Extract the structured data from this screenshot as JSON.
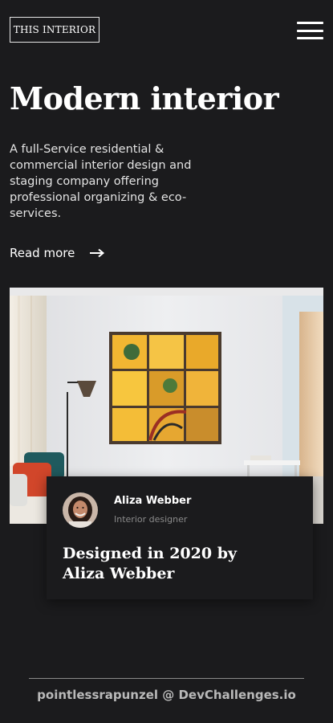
{
  "header": {
    "logo_text": "THIS INTERIOR",
    "menu_icon": "hamburger-menu-icon"
  },
  "hero": {
    "title": "Modern interior",
    "description": "A full-Service residential & commercial interior design and staging company offering professional organizing & eco-services.",
    "read_more_label": "Read more",
    "read_more_icon": "arrow-right-icon",
    "image": "living-room-interior-photo"
  },
  "card": {
    "author_name": "Aliza Webber",
    "author_role": "Interior designer",
    "title": "Designed in 2020 by Aliza Webber",
    "avatar": "avatar-photo"
  },
  "footer": {
    "credit": "pointlessrapunzel @ DevChallenges.io"
  },
  "colors": {
    "background": "#1b1b1d",
    "text": "#ffffff",
    "muted": "#8b8b8b",
    "footer_text": "#b9b9b9"
  }
}
